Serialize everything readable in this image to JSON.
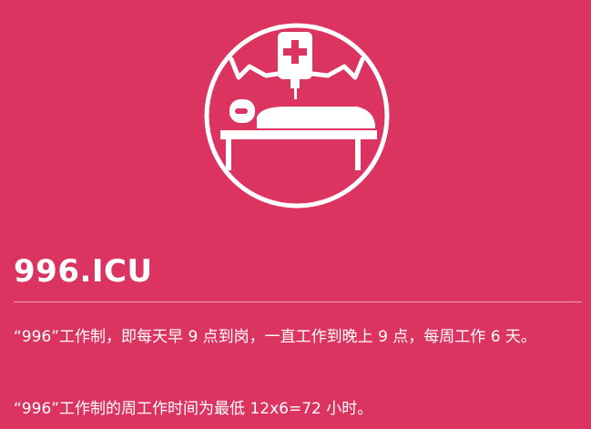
{
  "hero": {
    "icon": "hospital-bed-iv-icon",
    "title": "996.ICU"
  },
  "content": {
    "paragraphs": [
      "“996”工作制，即每天早 9 点到岗，一直工作到晚上 9 点，每周工作 6 天。",
      "“996”工作制的周工作时间为最低 12x6=72 小时。"
    ]
  },
  "colors": {
    "background": "#dc3460",
    "foreground": "#ffffff"
  }
}
